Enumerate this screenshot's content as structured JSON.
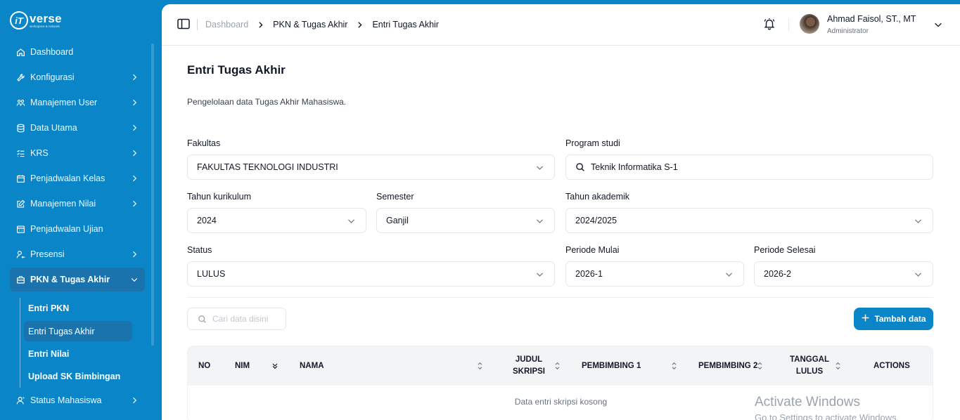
{
  "brand": {
    "mark": "iT",
    "name": "verse",
    "tagline": "workspace & network"
  },
  "sidebar": {
    "items": [
      {
        "label": "Dashboard",
        "icon": "home-icon",
        "has_chevron": false
      },
      {
        "label": "Konfigurasi",
        "icon": "wrench-icon",
        "has_chevron": true
      },
      {
        "label": "Manajemen User",
        "icon": "users-icon",
        "has_chevron": true
      },
      {
        "label": "Data Utama",
        "icon": "database-icon",
        "has_chevron": true
      },
      {
        "label": "KRS",
        "icon": "list-check-icon",
        "has_chevron": true
      },
      {
        "label": "Penjadwalan Kelas",
        "icon": "calendar-icon",
        "has_chevron": true
      },
      {
        "label": "Manajemen Nilai",
        "icon": "edit-icon",
        "has_chevron": true
      },
      {
        "label": "Penjadwalan Ujian",
        "icon": "calendar-grid-icon",
        "has_chevron": false
      },
      {
        "label": "Presensi",
        "icon": "user-search-icon",
        "has_chevron": true
      },
      {
        "label": "PKN & Tugas Akhir",
        "icon": "briefcase-icon",
        "has_chevron": true,
        "expanded": true,
        "active": true
      },
      {
        "label": "Status Mahasiswa",
        "icon": "user-status-icon",
        "has_chevron": true
      }
    ],
    "subitems": [
      {
        "label": "Entri PKN",
        "active": false
      },
      {
        "label": "Entri Tugas Akhir",
        "active": true
      },
      {
        "label": "Entri Nilai",
        "active": false
      },
      {
        "label": "Upload SK Bimbingan",
        "active": false
      }
    ]
  },
  "breadcrumb": [
    "Dashboard",
    "PKN & Tugas Akhir",
    "Entri Tugas Akhir"
  ],
  "user": {
    "name": "Ahmad Faisol, ST., MT",
    "role": "Administrator"
  },
  "page": {
    "title": "Entri Tugas Akhir",
    "description": "Pengelolaan data Tugas Akhir Mahasiswa."
  },
  "filters": {
    "fakultas": {
      "label": "Fakultas",
      "value": "FAKULTAS TEKNOLOGI INDUSTRI"
    },
    "program_studi": {
      "label": "Program studi",
      "value": "Teknik Informatika S-1"
    },
    "tahun_kurikulum": {
      "label": "Tahun kurikulum",
      "value": "2024"
    },
    "semester": {
      "label": "Semester",
      "value": "Ganjil"
    },
    "tahun_akademik": {
      "label": "Tahun akademik",
      "value": "2024/2025"
    },
    "status": {
      "label": "Status",
      "value": "LULUS"
    },
    "periode_mulai": {
      "label": "Periode Mulai",
      "value": "2026-1"
    },
    "periode_selesai": {
      "label": "Periode Selesai",
      "value": "2026-2"
    }
  },
  "search": {
    "placeholder": "Cari data disini",
    "value": ""
  },
  "add_button": {
    "label": "Tambah data"
  },
  "table": {
    "columns": {
      "no": "NO",
      "nim": "NIM",
      "nama": "NAMA",
      "judul_line1": "JUDUL",
      "judul_line2": "SKRIPSI",
      "pembimbing1": "PEMBIMBING 1",
      "pembimbing2": "PEMBIMBING 2",
      "tanggal_line1": "TANGGAL",
      "tanggal_line2": "LULUS",
      "actions": "ACTIONS"
    },
    "rows": [],
    "empty_message": "Data entri skripsi kosong"
  },
  "watermark": {
    "title": "Activate Windows",
    "subtitle": "Go to Settings to activate Windows."
  },
  "colors": {
    "primary": "#0a86c8",
    "active_nav": "#1b73ad",
    "table_header": "#f3f4f6"
  }
}
